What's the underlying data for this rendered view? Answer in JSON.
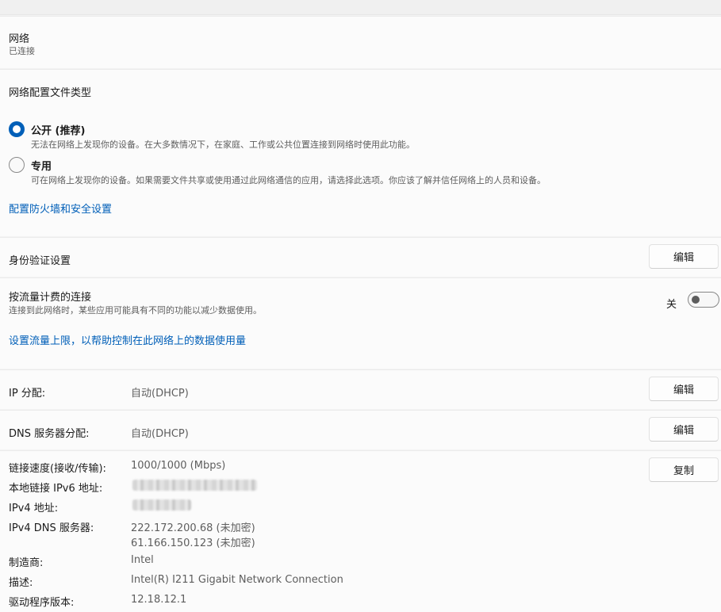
{
  "network": {
    "title": "网络",
    "status": "已连接"
  },
  "profile": {
    "heading": "网络配置文件类型",
    "public": {
      "label": "公开 (推荐)",
      "desc": "无法在网络上发现你的设备。在大多数情况下，在家庭、工作或公共位置连接到网络时使用此功能。",
      "selected": true
    },
    "private": {
      "label": "专用",
      "desc": "可在网络上发现你的设备。如果需要文件共享或使用通过此网络通信的应用，请选择此选项。你应该了解并信任网络上的人员和设备。",
      "selected": false
    },
    "firewall_link": "配置防火墙和安全设置"
  },
  "auth": {
    "label": "身份验证设置",
    "button": "编辑"
  },
  "metered": {
    "label": "按流量计费的连接",
    "desc": "连接到此网络时，某些应用可能具有不同的功能以减少数据使用。",
    "toggle_state": "关",
    "toggle_on": false,
    "limit_link": "设置流量上限，以帮助控制在此网络上的数据使用量"
  },
  "ip": {
    "label": "IP 分配:",
    "value": "自动(DHCP)",
    "button": "编辑"
  },
  "dns": {
    "label": "DNS 服务器分配:",
    "value": "自动(DHCP)",
    "button": "编辑"
  },
  "details": {
    "copy_button": "复制",
    "speed_label": "链接速度(接收/传输):",
    "speed_value": "1000/1000 (Mbps)",
    "ipv6_label": "本地链接 IPv6 地址:",
    "ipv4_label": "IPv4 地址:",
    "dns_label": "IPv4 DNS 服务器:",
    "dns_value_1": "222.172.200.68 (未加密)",
    "dns_value_2": "61.166.150.123 (未加密)",
    "maker_label": "制造商:",
    "maker_value": "Intel",
    "desc_label": "描述:",
    "desc_value": "Intel(R) I211 Gigabit Network Connection",
    "driver_label": "驱动程序版本:",
    "driver_value": "12.18.12.1"
  },
  "colors": {
    "accent": "#005fb8",
    "card": "#fbfbfb",
    "background": "#f3f3f3"
  }
}
